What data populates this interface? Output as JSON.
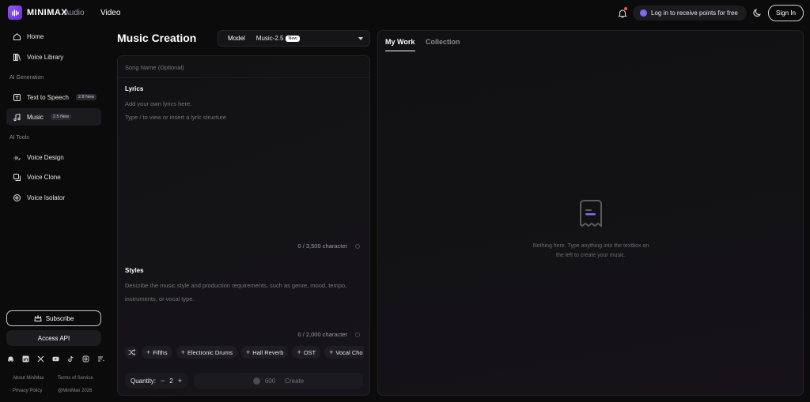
{
  "topbar": {
    "brand": "MINIMAX",
    "nav_audio": "Audio",
    "nav_video": "Video",
    "login_prompt": "Log in to receive points for free",
    "signin_label": "Sign In"
  },
  "sidebar": {
    "items_top": [
      {
        "label": "Home",
        "icon": "home-icon"
      },
      {
        "label": "Voice Library",
        "icon": "library-icon"
      }
    ],
    "section_generation": "AI Generation",
    "items_generation": [
      {
        "label": "Text to Speech",
        "badge": "2.8 New",
        "icon": "tts-icon"
      },
      {
        "label": "Music",
        "badge": "2.5 New",
        "icon": "music-icon"
      }
    ],
    "section_tools": "AI Tools",
    "items_tools": [
      {
        "label": "Voice Design",
        "icon": "voice-design-icon"
      },
      {
        "label": "Voice Clone",
        "icon": "voice-clone-icon"
      },
      {
        "label": "Voice Isolator",
        "icon": "voice-isolator-icon"
      }
    ],
    "subscribe_label": "Subscribe",
    "api_label": "Access API",
    "footer": {
      "about": "About MiniMax",
      "terms": "Terms of Service",
      "privacy": "Privacy Policy",
      "copyright": "@MiniMax 2026"
    }
  },
  "main": {
    "title": "Music Creation",
    "model_label": "Model",
    "model_value": "Music-2.5",
    "model_tag": "New"
  },
  "editor": {
    "song_name_placeholder": "Song Name (Optional)",
    "lyrics_title": "Lyrics",
    "lyrics_placeholder_1": "Add your own lyrics here.",
    "lyrics_placeholder_2": "Type / to view or insert a lyric structure",
    "lyrics_counter": "0 / 3,500 character",
    "styles_title": "Styles",
    "styles_placeholder": "Describe the music style and production requirements, such as genre, mood, tempo, instruments, or vocal type.",
    "styles_counter": "0 / 2,000 character",
    "chips": [
      "Fifths",
      "Electronic Drums",
      "Hall Reverb",
      "OST",
      "Vocal Cho"
    ],
    "quantity_label": "Quantity:",
    "quantity_value": "2",
    "qty_minus": "−",
    "qty_plus": "+",
    "create_cost": "600",
    "create_label": "Create"
  },
  "work": {
    "tab_my_work": "My Work",
    "tab_collection": "Collection",
    "empty_line_1": "Nothing here. Type anything into the textbox on",
    "empty_line_2": "the left to create your music."
  }
}
